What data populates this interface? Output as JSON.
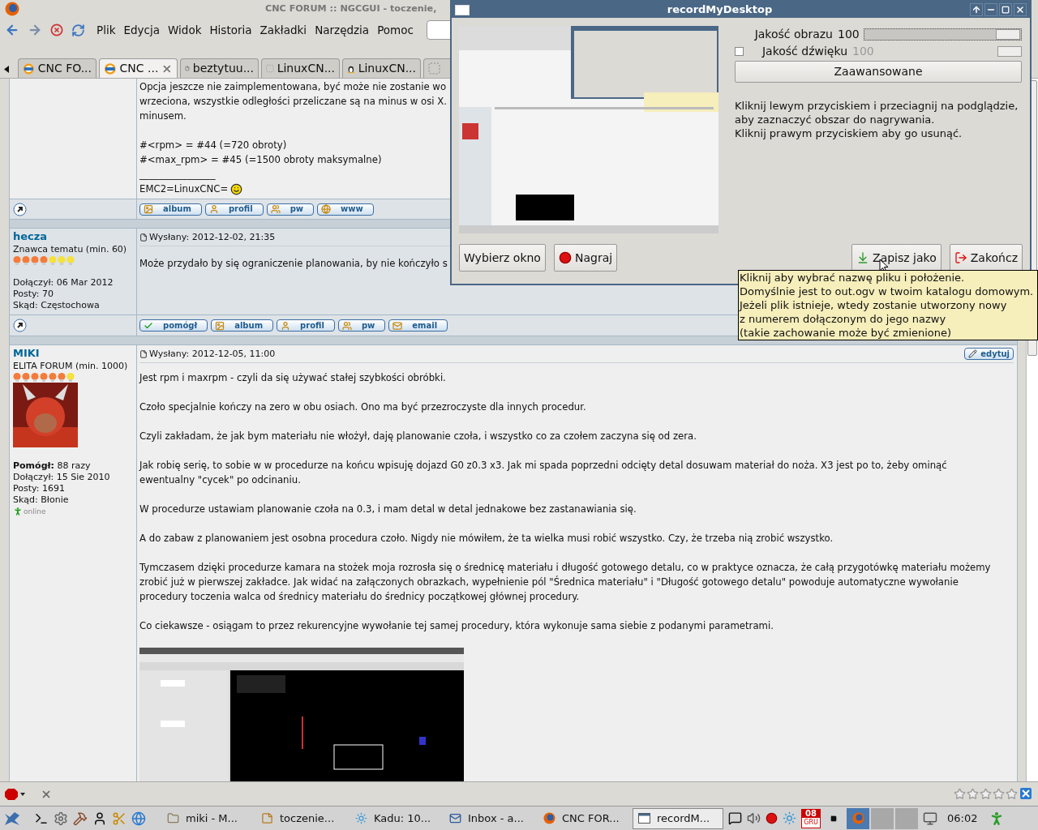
{
  "window": {
    "title": "CNC FORUM :: NGCGUI - toczenie,"
  },
  "menu": [
    "Plik",
    "Edycja",
    "Widok",
    "Historia",
    "Zakładki",
    "Narzędzia",
    "Pomoc"
  ],
  "tabs": [
    {
      "label": "CNC FO...",
      "selected": false,
      "kind": "cnc"
    },
    {
      "label": "CNC ...",
      "selected": true,
      "kind": "cnc"
    },
    {
      "label": "beztytuu...",
      "selected": false,
      "kind": "page"
    },
    {
      "label": "LinuxCN...",
      "selected": false,
      "kind": "blank"
    },
    {
      "label": "LinuxCN...",
      "selected": false,
      "kind": "penguin"
    },
    {
      "selected": false,
      "kind": "blank"
    }
  ],
  "posts": [
    {
      "paragraphs": [
        [
          "Opcja jeszcze nie zaimplementowana, być może nie zostanie wo",
          "wrzeciona, wszystkie odległości przeliczane są na minus w osi X.",
          "minusem."
        ],
        [
          "#<rpm> = #44 (=720 obroty)",
          "#<max_rpm> = #45 (=1500 obroty maksymalne)"
        ]
      ],
      "separator": "________________",
      "signature": "EMC2=LinuxCNC=",
      "buttons": [
        {
          "label": "album",
          "kind": "album"
        },
        {
          "label": "profil",
          "kind": "profil"
        },
        {
          "label": "pw",
          "kind": "pw"
        },
        {
          "label": "www",
          "kind": "www"
        }
      ]
    },
    {
      "author": "hecza",
      "rank": "Znawca tematu (min. 60)",
      "stars": 4,
      "details": [
        "Dołączył: 06 Mar 2012",
        "Posty: 70",
        "Skąd: Częstochowa"
      ],
      "posted": "Wysłany: 2012-12-02, 21:35",
      "paragraphs": [
        "Może przydało by się ograniczenie planowania, by nie kończyło s"
      ],
      "buttons": [
        {
          "label": "pomógł",
          "kind": "helped"
        },
        {
          "label": "album",
          "kind": "album"
        },
        {
          "label": "profil",
          "kind": "profil"
        },
        {
          "label": "pw",
          "kind": "pw"
        },
        {
          "label": "email",
          "kind": "email"
        }
      ]
    },
    {
      "author": "MIKI",
      "rank": "ELITA FORUM (min. 1000)",
      "stars": 6,
      "avatar": {
        "kind": "picture"
      },
      "details": [
        "**Pomógł:** 88 razy",
        "Dołączył: 15 Sie 2010",
        "Posty: 1691",
        "Skąd: Błonie"
      ],
      "status": "online",
      "posted": "Wysłany: 2012-12-05, 11:00",
      "edit": "edytuj",
      "paragraphs": [
        "Jest rpm i maxrpm - czyli da się używać stałej szybkości obróbki.",
        "Czoło specjalnie kończy na zero w obu osiach. Ono ma być przezroczyste dla innych procedur.",
        "Czyli zakładam, że jak bym materiału nie włożył, daję planowanie czoła, i wszystko co za czołem zaczyna się od zera.",
        "Jak robię serię, to sobie w w procedurze na końcu wpisuję dojazd G0 z0.3 x3. Jak mi spada poprzedni odcięty detal dosuwam materiał do noża. X3 jest po to, żeby ominąć ewentualny \"cycek\" po odcinaniu.",
        "W procedurze ustawiam planowanie czoła na 0.3, i mam detal w detal jednakowe bez zastanawiania się.",
        "A do zabaw z planowaniem jest osobna procedura czoło. Nigdy nie mówiłem, że ta wielka musi robić wszystko. Czy, że trzeba nią zrobić wszystko.",
        "Tymczasem dzięki procedurze kamara na stożek moja rozrosła się o średnicę materiału i długość gotowego detalu, co w praktyce oznacza, że całą przygotówkę materiału możemy zrobić już w pierwszej zakładce. Jak widać na załączonych obrazkach, wypełnienie pól \"Średnica materiału\" i \"Długość gotowego detalu\" powoduje automatyczne wywołanie procedury toczenia walca od średnicy materiału do średnicy początkowej głównej procedury.",
        "Co ciekawsze - osiągam to przez rekurencyjne wywołanie tej samej procedury, która wykonuje sama siebie z podanymi parametrami."
      ],
      "image": {
        "kind": "picture"
      }
    }
  ],
  "status_bar": {
    "stars": 0
  },
  "recorder": {
    "title": "recordMyDesktop",
    "preview": {
      "kind": "picture"
    },
    "video_quality": {
      "label": "Jakość obrazu",
      "value": "100",
      "level": 1
    },
    "sound_quality": {
      "label": "Jakość dźwięku",
      "value": "100",
      "checked": false,
      "disabled": true
    },
    "advanced": "Zaawansowane",
    "instructions": [
      "Kliknij lewym przyciskiem i przeciagnij na podglądzie,",
      "aby zaznaczyć obszar do nagrywania.",
      "Kliknij prawym przyciskiem aby go usunąć."
    ],
    "buttons": [
      {
        "label": "Wybierz okno",
        "kind": "plain"
      },
      {
        "label": "Nagraj",
        "kind": "record"
      },
      {
        "label": "Zapisz jako",
        "kind": "save"
      },
      {
        "label": "Zakończ",
        "kind": "quit"
      }
    ]
  },
  "tooltip": {
    "lines": [
      "Kliknij aby wybrać nazwę pliku i położenie.",
      "Domyślnie jest to out.ogv w twoim katalogu domowym.",
      "Jeżeli plik istnieje, wtedy zostanie utworzony nowy",
      "z numerem dołączonym do jego nazwy",
      "(takie zachowanie może być zmienione)"
    ]
  },
  "taskbar": {
    "tasks": [
      {
        "label": "miki - M...",
        "kind": "folder",
        "selected": false
      },
      {
        "label": "toczenie...",
        "kind": "note",
        "selected": false
      },
      {
        "label": "Kadu: 10...",
        "kind": "sun",
        "selected": false
      },
      {
        "label": "Inbox - a...",
        "kind": "mail",
        "selected": false
      },
      {
        "label": "CNC FOR...",
        "kind": "browser",
        "selected": false
      },
      {
        "label": "recordM...",
        "kind": "window",
        "selected": true
      }
    ],
    "calendar": {
      "day": "08",
      "month": "GRU"
    },
    "clock": "06:02"
  }
}
